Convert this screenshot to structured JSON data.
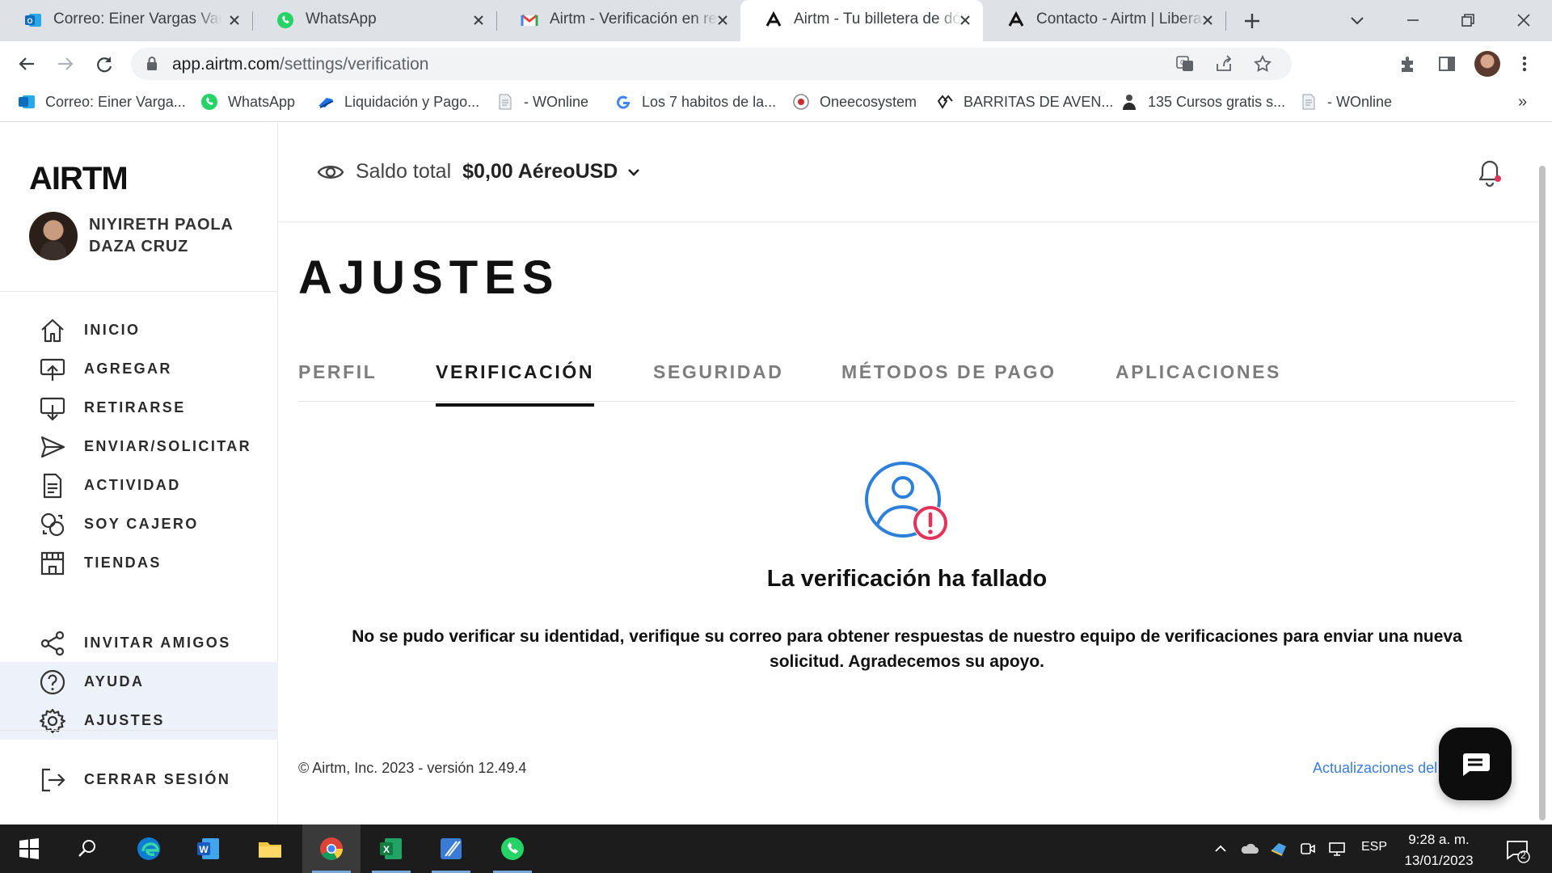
{
  "browser": {
    "tabs": [
      {
        "title": "Correo: Einer Vargas Vargas - Outlook",
        "icon": "outlook-icon"
      },
      {
        "title": "WhatsApp",
        "icon": "whatsapp-icon"
      },
      {
        "title": "Airtm - Verificación en revisión",
        "icon": "gmail-icon"
      },
      {
        "title": "Airtm - Tu billetera de dólares",
        "icon": "airtm-icon"
      },
      {
        "title": "Contacto - Airtm | Libera tu dinero",
        "icon": "airtm-icon"
      }
    ],
    "url_domain": "app.airtm.com",
    "url_path": "/settings/verification",
    "bookmarks": [
      {
        "label": "Correo: Einer Varga...",
        "icon": "outlook-icon"
      },
      {
        "label": "WhatsApp",
        "icon": "whatsapp-icon"
      },
      {
        "label": "Liquidación y Pago...",
        "icon": "bookmark-icon"
      },
      {
        "label": "- WOnline",
        "icon": "document-icon"
      },
      {
        "label": "Los 7 habitos de la...",
        "icon": "google-icon"
      },
      {
        "label": "Oneecosystem",
        "icon": "oneecosystem-icon"
      },
      {
        "label": "BARRITAS DE AVEN...",
        "icon": "bookmark-icon"
      },
      {
        "label": "135 Cursos gratis s...",
        "icon": "person-icon"
      },
      {
        "label": "- WOnline",
        "icon": "document-icon"
      }
    ],
    "overflow": "»"
  },
  "app": {
    "logo_text": "AIRTM",
    "user_name": "NIYIRETH PAOLA DAZA CRUZ",
    "nav": [
      {
        "label": "INICIO",
        "icon": "home-icon"
      },
      {
        "label": "AGREGAR",
        "icon": "add-funds-icon"
      },
      {
        "label": "RETIRARSE",
        "icon": "withdraw-icon"
      },
      {
        "label": "ENVIAR/SOLICITAR",
        "icon": "send-icon"
      },
      {
        "label": "ACTIVIDAD",
        "icon": "activity-icon"
      },
      {
        "label": "SOY CAJERO",
        "icon": "cashier-icon"
      },
      {
        "label": "TIENDAS",
        "icon": "store-icon"
      }
    ],
    "nav_bottom": [
      {
        "label": "INVITAR AMIGOS",
        "icon": "share-icon"
      },
      {
        "label": "AYUDA",
        "icon": "help-icon"
      },
      {
        "label": "AJUSTES",
        "icon": "settings-icon"
      }
    ],
    "logout": "CERRAR SESIÓN",
    "balance_label": "Saldo total",
    "balance_amount": "$0,00 AéreoUSD",
    "page_title": "AJUSTES",
    "settings_tabs": [
      "PERFIL",
      "VERIFICACIÓN",
      "SEGURIDAD",
      "MÉTODOS DE PAGO",
      "APLICACIONES"
    ],
    "active_tab": "VERIFICACIÓN",
    "verification_title": "La verificación ha fallado",
    "verification_message": "No se pudo verificar su identidad, verifique su correo para obtener respuestas de nuestro equipo de verificaciones para enviar una nueva solicitud. Agradecemos su apoyo.",
    "footer": "© Airtm, Inc. 2023 - versión 12.49.4",
    "updates_link": "Actualizaciones del sitio"
  },
  "taskbar": {
    "language": "ESP",
    "time": "9:28 a. m.",
    "date": "13/01/2023",
    "notifications": "2"
  },
  "colors": {
    "accent": "#2e7fd9",
    "alert": "#e2335a",
    "highlight": "#edf2fa"
  }
}
